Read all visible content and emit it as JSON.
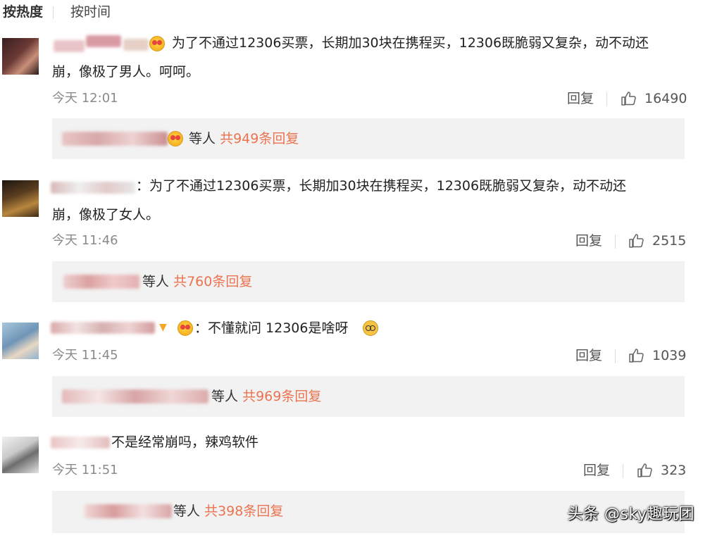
{
  "sort": {
    "hot": "按热度",
    "time": "按时间"
  },
  "comments": [
    {
      "text_line1": "为了不通过12306买票，长期加30块在携程买，12306既脆弱又复杂，动不动还",
      "text_line2": "崩，像极了男人。呵呵。",
      "time": "今天 12:01",
      "reply_label": "回复",
      "likes": "16490",
      "reply_suffix": "等人",
      "reply_total": "共949条回复"
    },
    {
      "text_line1": "：为了不通过12306买票，长期加30块在携程买，12306既脆弱又复杂，动不动还",
      "text_line2": "崩，像极了女人。",
      "time": "今天 11:46",
      "reply_label": "回复",
      "likes": "2515",
      "reply_suffix": "等人",
      "reply_total": "共760条回复"
    },
    {
      "text_line1": "：不懂就问 12306是啥呀",
      "time": "今天 11:45",
      "reply_label": "回复",
      "likes": "1039",
      "reply_suffix": "等人",
      "reply_total": "共969条回复"
    },
    {
      "text_line1": "不是经常崩吗，辣鸡软件",
      "time": "今天 11:51",
      "reply_label": "回复",
      "likes": "323",
      "reply_suffix": "等人",
      "reply_total": "共398条回复"
    }
  ],
  "watermark": "头条 @sky趣玩团",
  "colors": {
    "link": "#eb7350",
    "background": "#ffffff",
    "reply_bg": "#f2f2f2"
  },
  "icons": {
    "like": "thumbs-up-icon",
    "emoji": "heart-eyes-emoji",
    "confused": "dizzy-face-emoji"
  }
}
